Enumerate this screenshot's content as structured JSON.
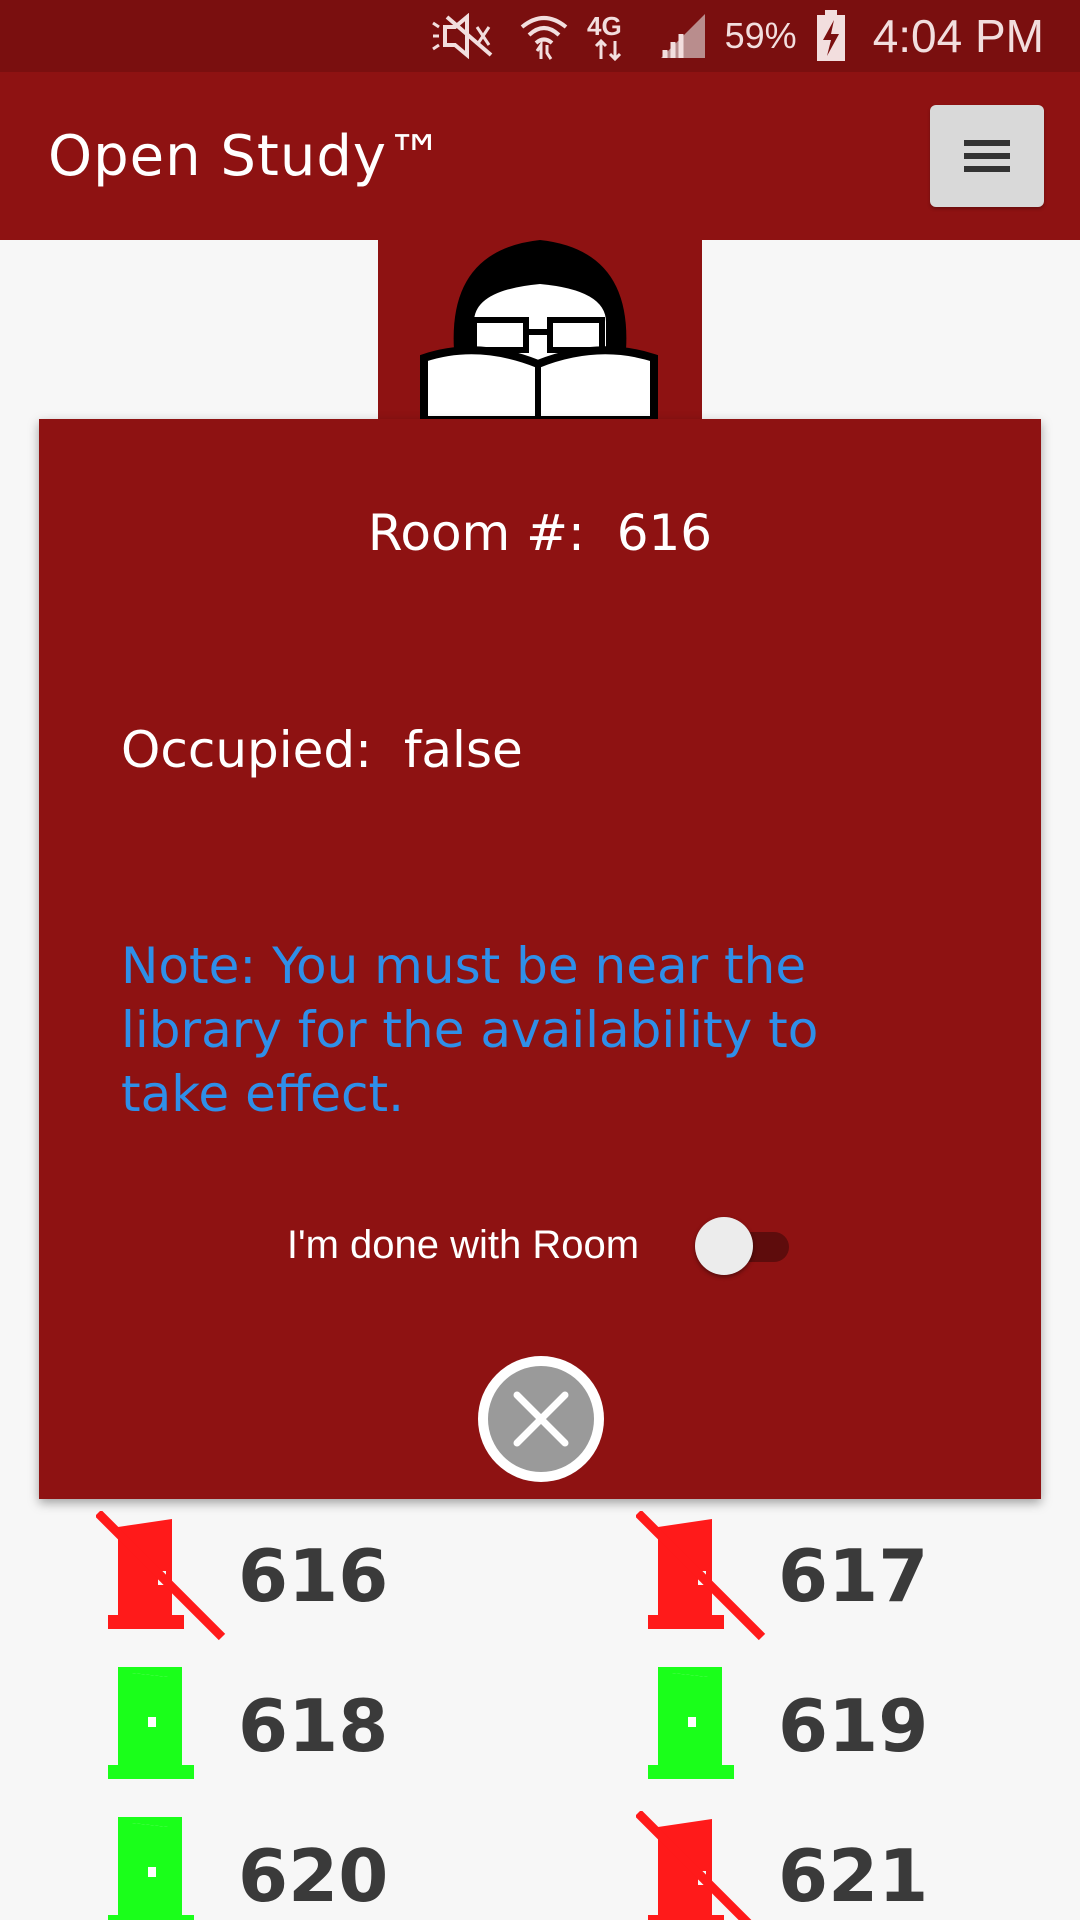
{
  "status_bar": {
    "battery": "59%",
    "time": "4:04 PM",
    "network": "4G",
    "icons": [
      "mute-icon",
      "wifi-icon",
      "network-4g-icon",
      "signal-icon",
      "battery-charging-icon"
    ]
  },
  "app_bar": {
    "title": "Open Study™",
    "menu_icon": "hamburger-menu-icon"
  },
  "dialog": {
    "room_label": "Room #:",
    "room_number": "616",
    "occupied_label": "Occupied:",
    "occupied_value": "false",
    "note": "Note: You must be near the library for the availability to take effect.",
    "done_label": "I'm done with Room",
    "done_toggle_on": false,
    "close_icon": "close-circle-icon"
  },
  "rooms": [
    {
      "number": "616",
      "status": "occupied"
    },
    {
      "number": "617",
      "status": "occupied"
    },
    {
      "number": "618",
      "status": "available"
    },
    {
      "number": "619",
      "status": "available"
    },
    {
      "number": "620",
      "status": "available"
    },
    {
      "number": "621",
      "status": "occupied"
    }
  ],
  "colors": {
    "primary": "#8e1212",
    "status_bar": "#7a0f0f",
    "note_text": "#2f8fe8",
    "occupied": "#ff1a1a",
    "available": "#1aff1a"
  }
}
